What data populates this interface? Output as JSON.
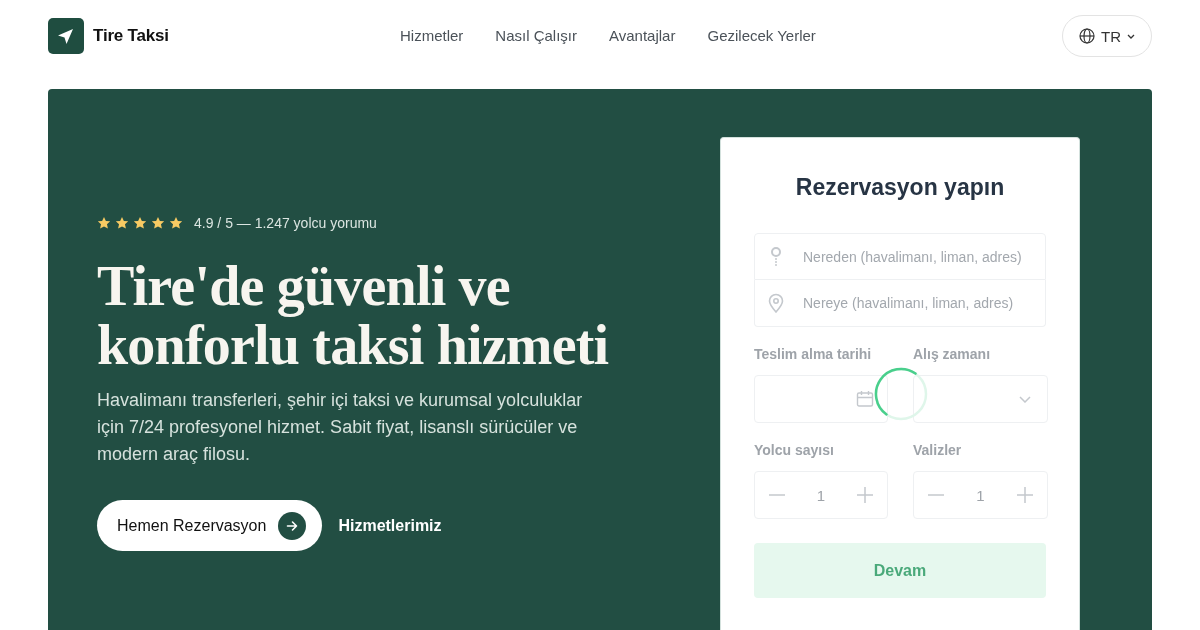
{
  "header": {
    "brand": "Tire Taksi",
    "nav": [
      "Hizmetler",
      "Nasıl Çalışır",
      "Avantajlar",
      "Gezilecek Yerler"
    ],
    "language": "TR"
  },
  "hero": {
    "rating": {
      "stars": 5,
      "text": "4.9 / 5 — 1.247 yolcu yorumu"
    },
    "title": "Tire'de güvenli ve konforlu taksi hizmeti",
    "description": "Havalimanı transferleri, şehir içi taksi ve kurumsal yolculuklar için 7/24 profesyonel hizmet. Sabit fiyat, lisanslı sürücüler ve modern araç filosu.",
    "primary_button": "Hemen Rezervasyon",
    "secondary_link": "Hizmetlerimiz"
  },
  "booking": {
    "title": "Rezervasyon yapın",
    "loading": true,
    "from": {
      "placeholder": "Nereden (havalimanı, liman, adres)"
    },
    "to": {
      "placeholder": "Nereye (havalimanı, liman, adres)"
    },
    "date": {
      "label": "Teslim alma tarihi"
    },
    "time": {
      "label": "Alış zamanı"
    },
    "passengers": {
      "label": "Yolcu sayısı",
      "value": "1"
    },
    "luggage": {
      "label": "Valizler",
      "value": "1"
    },
    "submit": "Devam"
  }
}
